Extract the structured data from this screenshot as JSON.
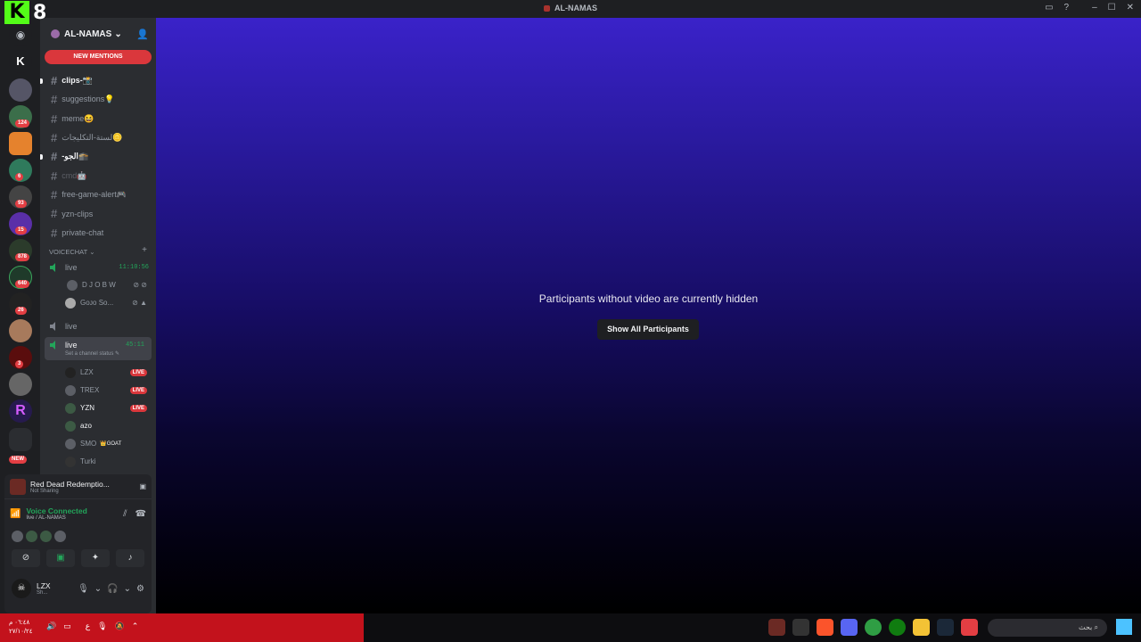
{
  "window": {
    "title": "AL-NAMAS"
  },
  "overlay": {
    "logo_letter": "K",
    "logo_number": "8"
  },
  "server": {
    "name": "AL-NAMAS",
    "new_mentions": "NEW MENTIONS"
  },
  "rail": {
    "badges": [
      "124",
      "6",
      "93",
      "15",
      "878",
      "640",
      "26",
      "3"
    ],
    "new_label": "NEW"
  },
  "channels": [
    {
      "name": "clips-📸",
      "state": "unread"
    },
    {
      "name": "suggestions💡",
      "state": "normal"
    },
    {
      "name": "meme😆",
      "state": "normal"
    },
    {
      "name": "لستة-التكليجات🪙",
      "state": "normal"
    },
    {
      "name": "-الجو🕋",
      "state": "unread"
    },
    {
      "name": "cmd🤖",
      "state": "muted"
    },
    {
      "name": "free-game-alert🎮",
      "state": "normal"
    },
    {
      "name": "yzn-clips",
      "state": "normal"
    },
    {
      "name": "private-chat",
      "state": "normal"
    }
  ],
  "voice_category": "VOICECHAT",
  "voice1": {
    "name": "live",
    "timer": "11:10:56",
    "members": [
      "D J O B W",
      "Gᴏᴊᴏ Sᴏ..."
    ]
  },
  "voice2": {
    "name": "live"
  },
  "voice3": {
    "name": "live",
    "timer": "45:11",
    "status": "Set a channel status",
    "members": [
      {
        "name": "LZX",
        "live": "LIVE"
      },
      {
        "name": "TREX",
        "live": "LIVE"
      },
      {
        "name": "YZN",
        "live": "LIVE"
      },
      {
        "name": "azo"
      },
      {
        "name": "SMO",
        "tag": "👑GOAT"
      },
      {
        "name": "Turki"
      }
    ]
  },
  "activity": {
    "game": "Red Dead Redemptio...",
    "status": "Not Sharing"
  },
  "voice_connection": {
    "state": "Voice Connected",
    "where": "live / AL-NAMAS"
  },
  "user": {
    "name": "LZX",
    "status": "Sh..."
  },
  "stage": {
    "message": "Participants without video are currently hidden",
    "button": "Show All Participants"
  },
  "taskbar": {
    "time": "٠٦:٤٨ م",
    "date": "٢٧/١٠/٢٤",
    "lang": "ع",
    "search_placeholder": "بحث"
  }
}
